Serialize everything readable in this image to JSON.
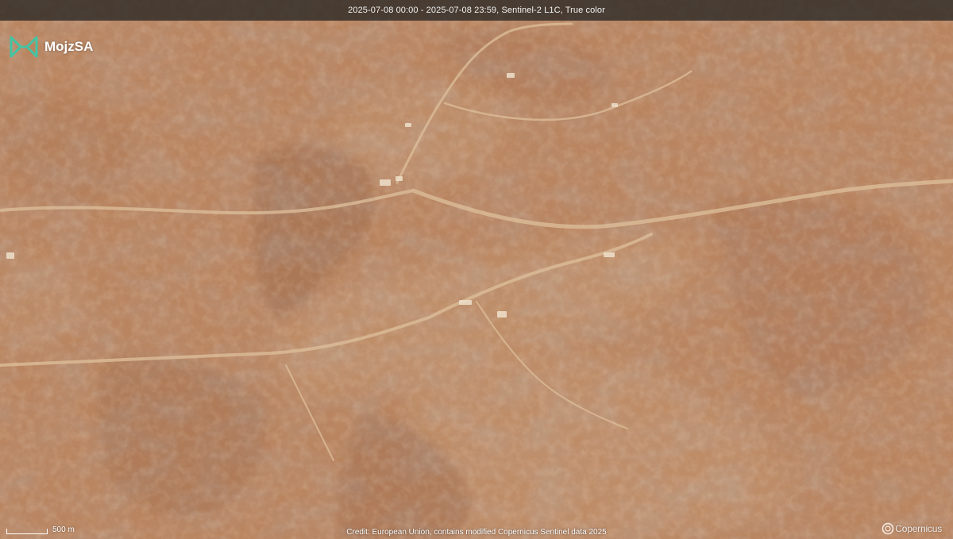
{
  "header": {
    "caption": "2025-07-08 00:00 - 2025-07-08 23:59, Sentinel-2 L1C, True color"
  },
  "brand": {
    "name": "MojzSA",
    "logo_icon": "mojzsa-logo-icon",
    "logo_color": "#43c4a3"
  },
  "map": {
    "scale_label": "500 m",
    "credit": "Credit: European Union, contains modified Copernicus Sentinel data 2025",
    "watermark": "Copernicus",
    "terrain_colors": {
      "base": "#b98560",
      "dark_ridge": "#7a4d36",
      "light_plain": "#d3ad86",
      "wadi": "#d9bb98"
    }
  }
}
